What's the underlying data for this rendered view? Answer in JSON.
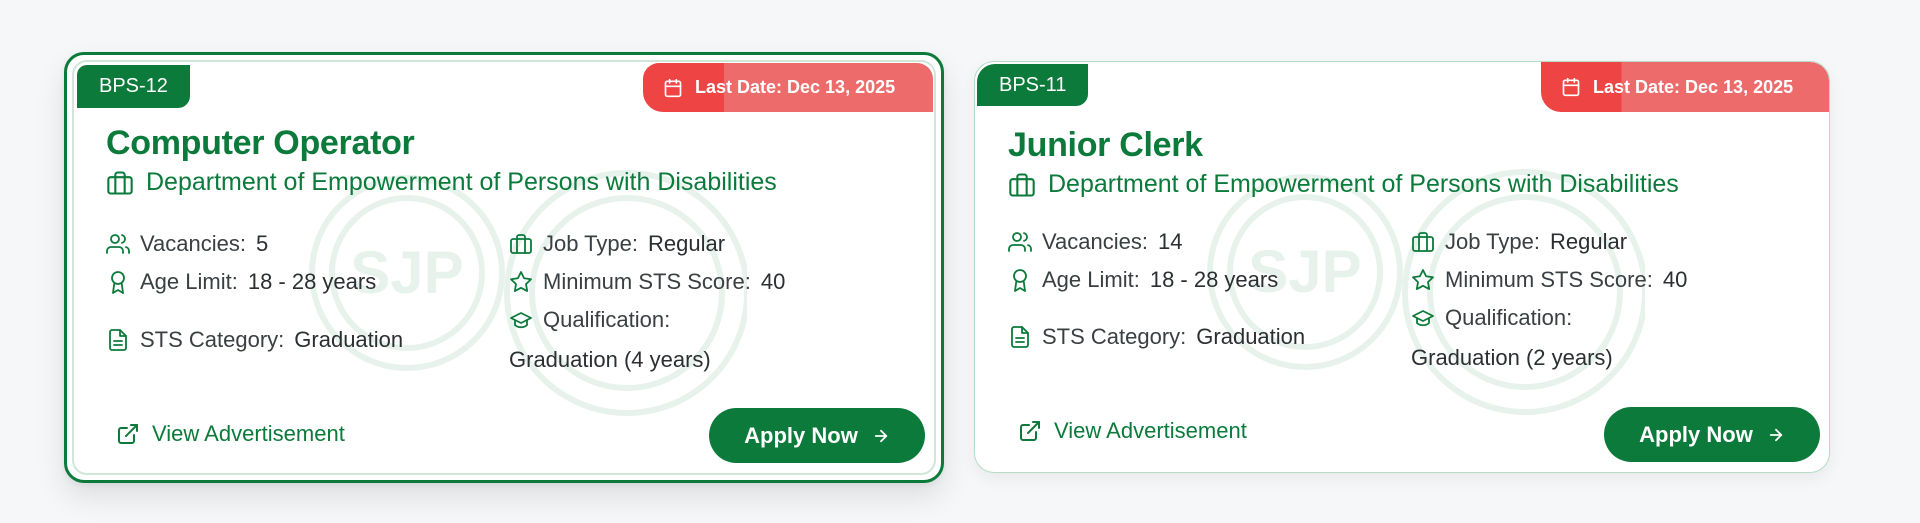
{
  "cards": [
    {
      "grade": "BPS-12",
      "last_date": "Last Date: Dec 13, 2025",
      "title": "Computer Operator",
      "department": "Department of Empowerment of Persons with Disabilities",
      "vacancies_label": "Vacancies:",
      "vacancies": "5",
      "age_label": "Age Limit:",
      "age": "18 - 28 years",
      "sts_category_label": "STS Category:",
      "sts_category": "Graduation",
      "job_type_label": "Job Type:",
      "job_type": "Regular",
      "min_sts_label": "Minimum STS Score:",
      "min_sts": "40",
      "qualification_label": "Qualification:",
      "qualification": "Graduation (4 years)",
      "view_ad": "View Advertisement",
      "apply": "Apply Now",
      "watermark": "SJP"
    },
    {
      "grade": "BPS-11",
      "last_date": "Last Date: Dec 13, 2025",
      "title": "Junior Clerk",
      "department": "Department of Empowerment of Persons with Disabilities",
      "vacancies_label": "Vacancies:",
      "vacancies": "14",
      "age_label": "Age Limit:",
      "age": "18 - 28 years",
      "sts_category_label": "STS Category:",
      "sts_category": "Graduation",
      "job_type_label": "Job Type:",
      "job_type": "Regular",
      "min_sts_label": "Minimum STS Score:",
      "min_sts": "40",
      "qualification_label": "Qualification:",
      "qualification": "Graduation (2 years)",
      "view_ad": "View Advertisement",
      "apply": "Apply Now",
      "watermark": "SJP"
    }
  ],
  "colors": {
    "brand_green": "#0b7a3b",
    "deadline_red": "#ef4444",
    "deadline_red_light": "#ee6b6b"
  },
  "icons": {
    "calendar": "calendar-icon",
    "department": "briefcase-icon",
    "vacancies": "users-icon",
    "age": "award-icon",
    "sts_category": "file-text-icon",
    "job_type": "briefcase-icon",
    "min_sts": "star-icon",
    "qualification": "graduation-cap-icon",
    "view_ad": "external-link-icon",
    "apply": "arrow-right-icon"
  }
}
